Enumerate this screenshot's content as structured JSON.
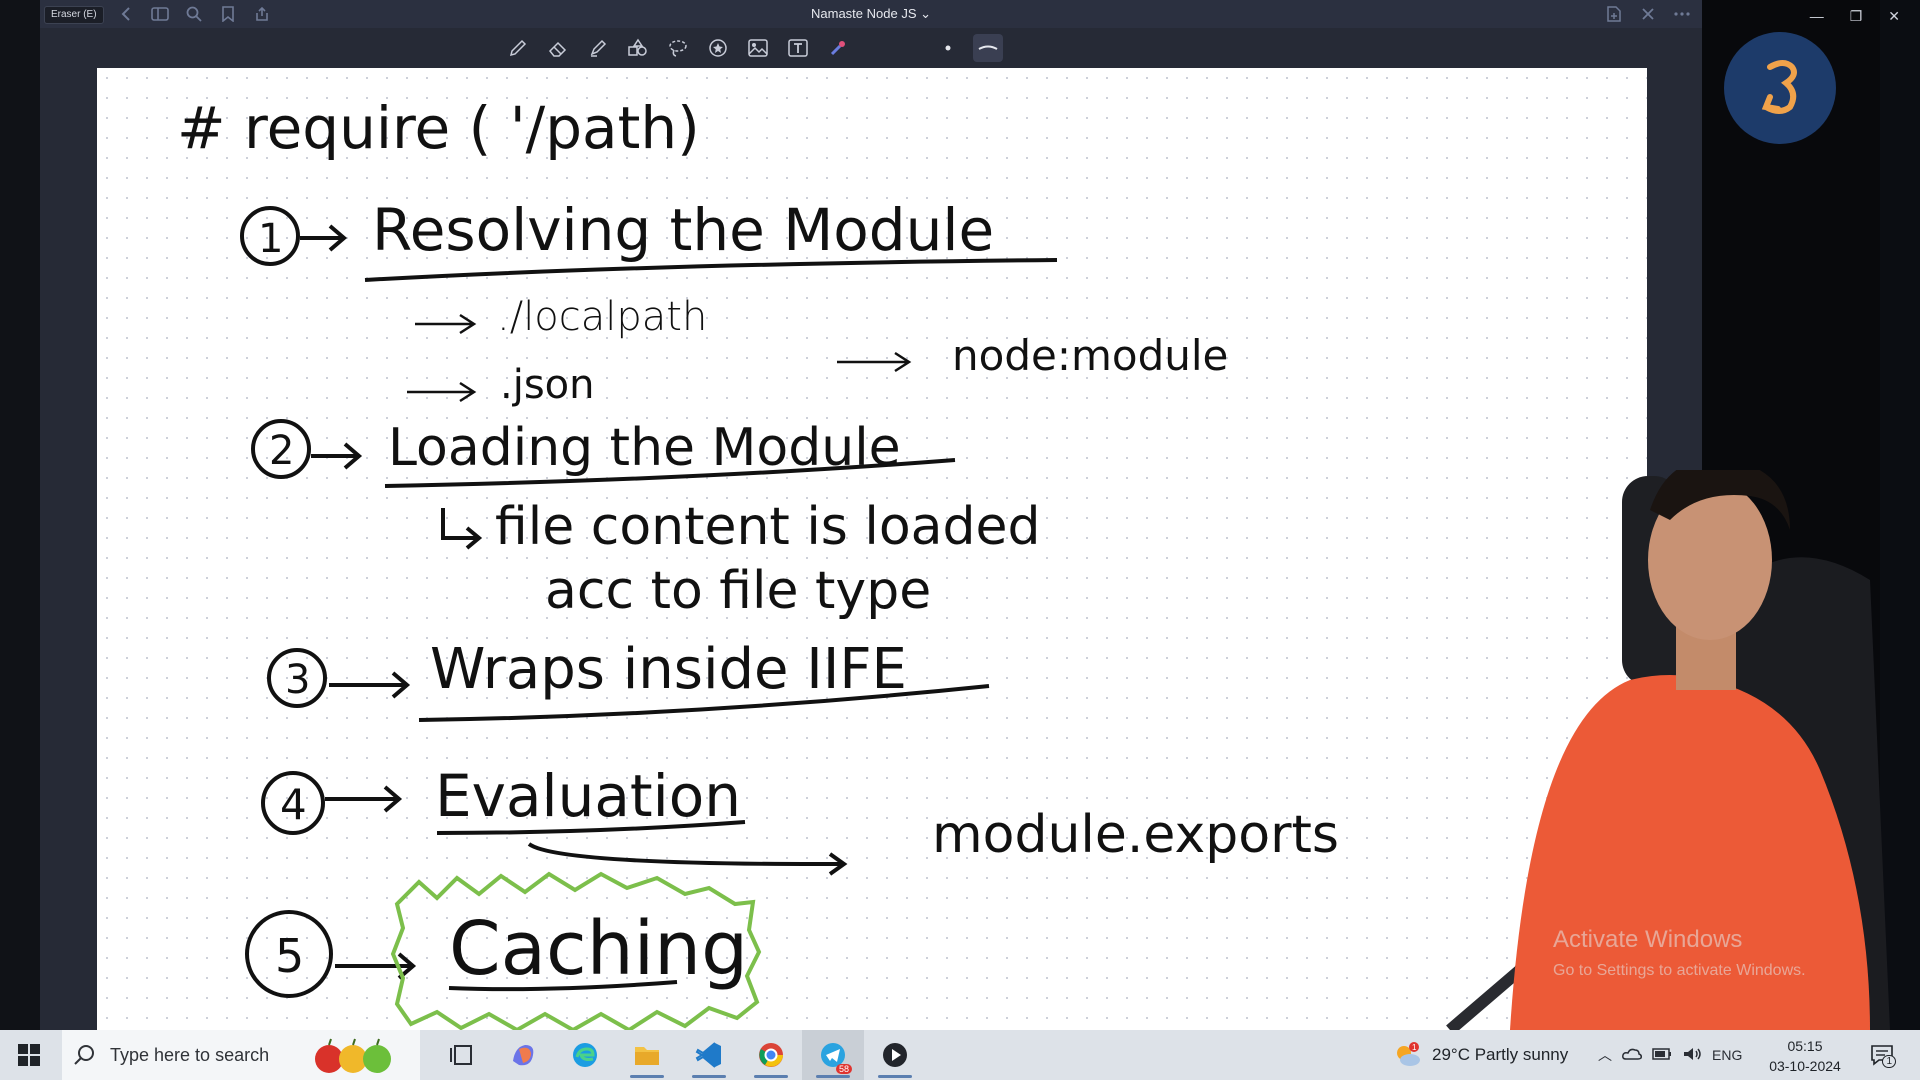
{
  "titlebar": {
    "tool_tag": "Eraser (E)",
    "title": "Namaste Node JS ⌄"
  },
  "whiteboard": {
    "heading": "# require ( '/path)",
    "steps": [
      {
        "num": "1",
        "label": "Resolving the Module"
      },
      {
        "num": "2",
        "label": "Loading the Module"
      },
      {
        "num": "3",
        "label": "Wraps inside IIFE"
      },
      {
        "num": "4",
        "label": "Evaluation"
      },
      {
        "num": "5",
        "label": "Caching"
      }
    ],
    "notes": {
      "localpath": "./localpath",
      "json": ".json",
      "node_module": "node:module",
      "file_content": "file content is loaded",
      "acc_type": "acc to file type",
      "module_exports": "module.exports"
    }
  },
  "watermark": {
    "line1": "Activate Windows",
    "line2": "Go to Settings to activate Windows."
  },
  "taskbar": {
    "search_placeholder": "Type here to search",
    "telegram_badge": "58",
    "weather": "29°C  Partly sunny",
    "language": "ENG",
    "time": "05:15",
    "date": "03-10-2024",
    "notification_count": "1"
  }
}
